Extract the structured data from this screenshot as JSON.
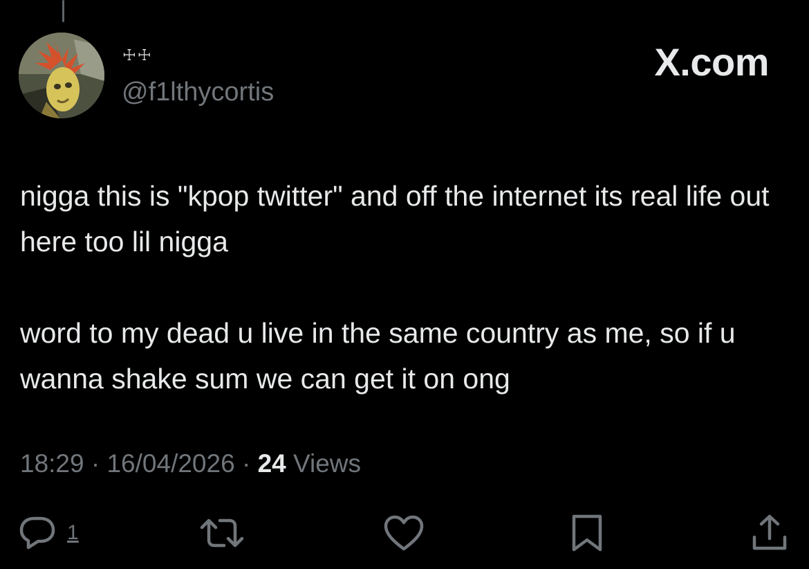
{
  "brand": "X.com",
  "tweet": {
    "author": {
      "display_name": "☩☩",
      "handle": "@f1lthycortis"
    },
    "paragraphs": [
      "nigga this is \"kpop twitter\" and off the internet its real life out here too lil nigga",
      "word to my dead u live in the same country as me, so if u wanna shake sum we can get it on ong"
    ],
    "meta": {
      "time": "18:29",
      "separator": " · ",
      "date": "16/04/2026",
      "views_count": "24",
      "views_label": " Views"
    },
    "actions": {
      "reply_count": "1"
    }
  },
  "icons": [
    "reply-icon",
    "repost-icon",
    "like-icon",
    "bookmark-icon",
    "share-icon"
  ],
  "colors": {
    "background": "#000000",
    "primary_text": "#e7e9ea",
    "secondary_text": "#71767b"
  }
}
